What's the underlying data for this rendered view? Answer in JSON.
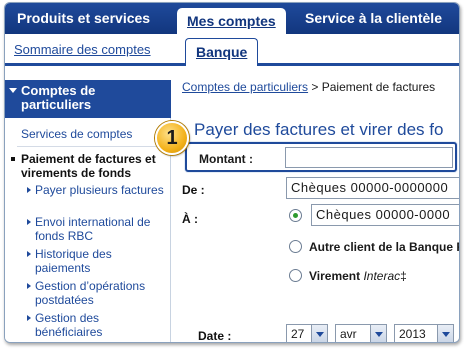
{
  "topnav": {
    "tabs": [
      "Produits et services",
      "Mes comptes",
      "Service à la clientèle"
    ],
    "active_index": 1
  },
  "subnav": {
    "summary_link": "Sommaire des comptes",
    "active_tab": "Banque"
  },
  "sidebar": {
    "heading": "Comptes de particuliers",
    "items": {
      "services": "Services de comptes",
      "current": "Paiement de factures et virements de fonds",
      "sub": [
        "Payer plusieurs factures",
        "Envoi international de fonds RBC",
        "Historique des paiements",
        "Gestion d’opérations postdatées",
        "Gestion des bénéficiaires"
      ]
    }
  },
  "main": {
    "breadcrumb_link": "Comptes de particuliers",
    "breadcrumb_rest": " > Paiement de factures",
    "title": "Payer des factures et virer des fo",
    "badge": "1",
    "montant_label": "Montant :",
    "montant_value": "",
    "de_label": "De :",
    "de_value": "Chèques 00000-0000000",
    "a_label": "À :",
    "a_value": "Chèques 00000-0000",
    "radio_other": "Autre client de la Banque R",
    "radio_virement": "Virement ",
    "radio_virement_em": "Interac",
    "date_label": "Date :",
    "date_day": "27",
    "date_month": "avr",
    "date_year": "2013"
  },
  "colors": {
    "brand_blue": "#1f4a9b",
    "badge_gold": "#f3b21b",
    "radio_green": "#2e9a2e"
  }
}
